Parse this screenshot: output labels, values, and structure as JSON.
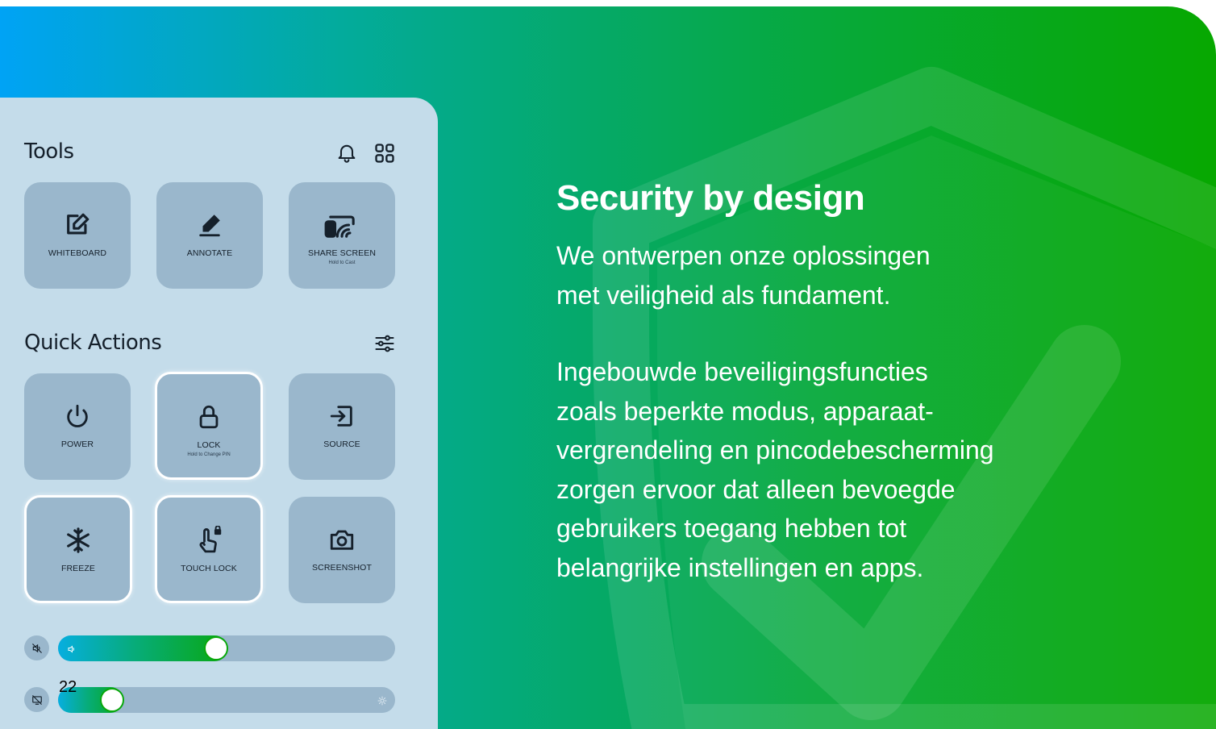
{
  "panel": {
    "tools_title": "Tools",
    "quick_actions_title": "Quick Actions",
    "header_icons": [
      "bell-icon",
      "grid-icon",
      "sliders-icon"
    ],
    "tools": [
      {
        "label": "WHITEBOARD",
        "sub": "",
        "icon": "whiteboard-icon"
      },
      {
        "label": "ANNOTATE",
        "sub": "",
        "icon": "pen-icon"
      },
      {
        "label": "SHARE SCREEN",
        "sub": "Hold to Cast",
        "icon": "cast-icon"
      }
    ],
    "quick_actions": [
      {
        "label": "POWER",
        "sub": "",
        "icon": "power-icon",
        "active": false
      },
      {
        "label": "LOCK",
        "sub": "Hold to Change PIN",
        "icon": "lock-icon",
        "active": true
      },
      {
        "label": "SOURCE",
        "sub": "",
        "icon": "source-icon",
        "active": false
      },
      {
        "label": "FREEZE",
        "sub": "",
        "icon": "snowflake-icon",
        "active": true
      },
      {
        "label": "TOUCH LOCK",
        "sub": "",
        "icon": "touch-lock-icon",
        "active": true
      },
      {
        "label": "SCREENSHOT",
        "sub": "",
        "icon": "camera-icon",
        "active": false
      }
    ],
    "volume": {
      "level_fraction": 0.47,
      "left_icon": "mute-icon",
      "inline_icon": "speaker-icon"
    },
    "brightness": {
      "value": "22",
      "level_fraction": 0.16,
      "left_icon": "screen-off-icon",
      "right_icon": "sun-icon"
    }
  },
  "hero": {
    "title": "Security by design",
    "paragraph1_lines": [
      "We ontwerpen onze oplossingen",
      "met veiligheid als fundament."
    ],
    "paragraph2_lines": [
      "Ingebouwde beveiligingsfuncties",
      "zoals beperkte modus, apparaat-",
      "vergrendeling en pincodebescherming",
      "zorgen ervoor dat alleen bevoegde",
      "gebruikers toegang hebben tot",
      "belangrijke instellingen en apps."
    ]
  },
  "colors": {
    "gradient_start": "#00a3f5",
    "gradient_end": "#07a800",
    "panel_bg": "#c4dcea",
    "tile_bg": "#9ab7cc",
    "text_dark": "#15202b"
  }
}
